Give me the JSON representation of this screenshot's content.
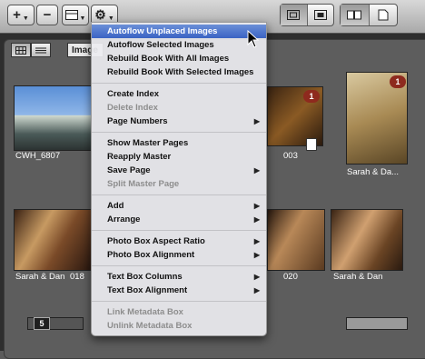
{
  "toolbar": {
    "add_label": "+",
    "remove_label": "−",
    "layout_icon": "layout-icon",
    "action_icon": "gear-icon",
    "view_icons": [
      "frame-icon",
      "page-icon"
    ],
    "mode_icons": [
      "book-open-icon",
      "single-page-icon"
    ]
  },
  "browser": {
    "sort_label": "Image",
    "tiles": [
      {
        "caption": "CWH_6807",
        "badge": ""
      },
      {
        "caption": "003",
        "badge": "1"
      },
      {
        "caption": "Sarah & Da...",
        "badge": "1"
      },
      {
        "caption": "Sarah & Dan",
        "badge": ""
      },
      {
        "caption": "018",
        "badge": ""
      },
      {
        "caption": "020",
        "badge": ""
      },
      {
        "caption": "Sarah & Dan",
        "badge": ""
      }
    ],
    "page_badge": "5"
  },
  "menu": {
    "items": [
      {
        "label": "Autoflow Unplaced Images",
        "enabled": true,
        "highlighted": true
      },
      {
        "label": "Autoflow Selected Images",
        "enabled": true
      },
      {
        "label": "Rebuild Book With All Images",
        "enabled": true
      },
      {
        "label": "Rebuild Book With Selected Images",
        "enabled": true
      },
      {
        "label": "Create Index",
        "enabled": true
      },
      {
        "label": "Delete Index",
        "enabled": false
      },
      {
        "label": "Page Numbers",
        "enabled": true,
        "submenu": true
      },
      {
        "label": "Show Master Pages",
        "enabled": true
      },
      {
        "label": "Reapply Master",
        "enabled": true
      },
      {
        "label": "Save Page",
        "enabled": true,
        "submenu": true
      },
      {
        "label": "Split Master Page",
        "enabled": false
      },
      {
        "label": "Add",
        "enabled": true,
        "submenu": true
      },
      {
        "label": "Arrange",
        "enabled": true,
        "submenu": true
      },
      {
        "label": "Photo Box Aspect Ratio",
        "enabled": true,
        "submenu": true
      },
      {
        "label": "Photo Box Alignment",
        "enabled": true,
        "submenu": true
      },
      {
        "label": "Text Box Columns",
        "enabled": true,
        "submenu": true
      },
      {
        "label": "Text Box Alignment",
        "enabled": true,
        "submenu": true
      },
      {
        "label": "Link Metadata Box",
        "enabled": false
      },
      {
        "label": "Unlink Metadata Box",
        "enabled": false
      }
    ],
    "submenu_arrow": "▶"
  },
  "colors": {
    "highlight": "#3a63c4",
    "badge": "#8e2a1e"
  }
}
